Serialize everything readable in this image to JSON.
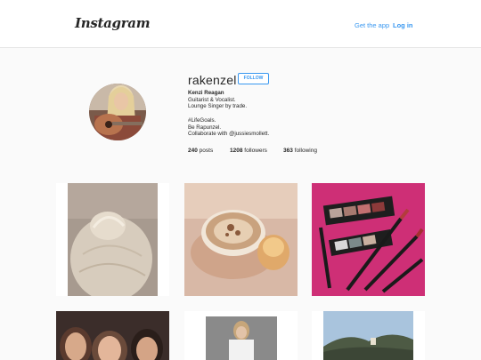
{
  "header": {
    "logo_text": "Instagram",
    "get_app_label": "Get the app",
    "login_label": "Log in"
  },
  "profile": {
    "username": "rakenzel",
    "follow_label": "FOLLOW",
    "full_name": "Kenzi Reagan",
    "bio_lines": [
      "Guitarist & Vocalist.",
      "Lounge Singer by trade.",
      "",
      "#LifeGoals.",
      "Be Rapunzel.",
      "Collaborate with @jussiesmollett."
    ],
    "stats": {
      "posts_count": "240",
      "posts_label": "posts",
      "followers_count": "1208",
      "followers_label": "followers",
      "following_count": "363",
      "following_label": "following"
    }
  },
  "posts": [
    {
      "name": "hair-bun-photo"
    },
    {
      "name": "cappuccino-photo"
    },
    {
      "name": "makeup-lipsticks-photo"
    },
    {
      "name": "friends-selfie-photo"
    },
    {
      "name": "woman-portrait-photo"
    },
    {
      "name": "hills-landscape-photo"
    }
  ],
  "colors": {
    "accent": "#3897f0",
    "background": "#fafafa",
    "text": "#262626"
  }
}
